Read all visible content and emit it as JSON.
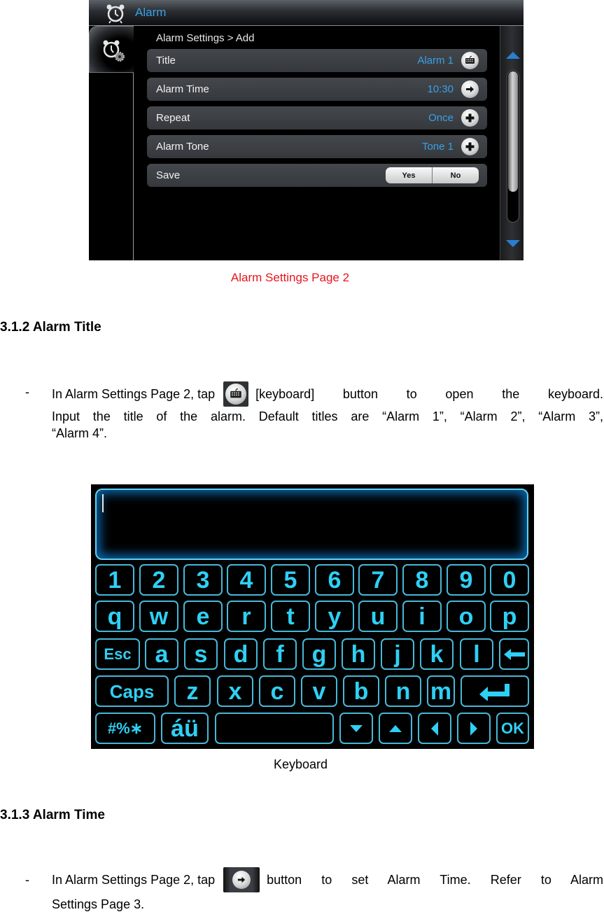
{
  "alarm_screen": {
    "header_title": "Alarm",
    "header_icon": "alarm-clock-icon",
    "side_tab_icon": "alarm-settings-icon",
    "breadcrumb": "Alarm Settings > Add",
    "rows": [
      {
        "label": "Title",
        "value": "Alarm 1",
        "action_icon": "keyboard-icon"
      },
      {
        "label": "Alarm Time",
        "value": "10:30",
        "action_icon": "arrow-right-icon"
      },
      {
        "label": "Repeat",
        "value": "Once",
        "action_icon": "plus-icon"
      },
      {
        "label": "Alarm Tone",
        "value": "Tone 1",
        "action_icon": "plus-icon"
      }
    ],
    "save_row": {
      "label": "Save",
      "yes_label": "Yes",
      "no_label": "No"
    },
    "accent_color": "#3aa0e8"
  },
  "caption_alarm": "Alarm Settings Page 2",
  "section_title": {
    "heading": "3.1.2 Alarm Title",
    "bullet": "-",
    "text_before_icon": "In Alarm Settings Page 2, tap",
    "text_after_icon": "[keyboard] button to open the keyboard.",
    "line2": "Input the title of the alarm. Default titles are “Alarm 1”, “Alarm 2”, “Alarm 3”,",
    "line3": "“Alarm 4”."
  },
  "keyboard": {
    "input_value": "",
    "row1": [
      "1",
      "2",
      "3",
      "4",
      "5",
      "6",
      "7",
      "8",
      "9",
      "0"
    ],
    "row2": [
      "q",
      "w",
      "e",
      "r",
      "t",
      "y",
      "u",
      "i",
      "o",
      "p"
    ],
    "row3": [
      "Esc",
      "a",
      "s",
      "d",
      "f",
      "g",
      "h",
      "j",
      "k",
      "l",
      "←"
    ],
    "row4": [
      "Caps",
      "z",
      "x",
      "c",
      "v",
      "b",
      "n",
      "m",
      "↵"
    ],
    "row5": [
      "#%∗",
      "áü",
      "",
      "▼",
      "▲",
      "◀",
      "▶",
      "OK"
    ],
    "key_color": "#2ed0f5"
  },
  "caption_keyboard": "Keyboard",
  "section_time": {
    "heading": "3.1.3 Alarm Time",
    "bullet": "-",
    "text_before_icon": "In Alarm Settings Page 2, tap",
    "text_after_icon": "button to set Alarm Time. Refer to Alarm",
    "line2": "Settings Page 3."
  }
}
